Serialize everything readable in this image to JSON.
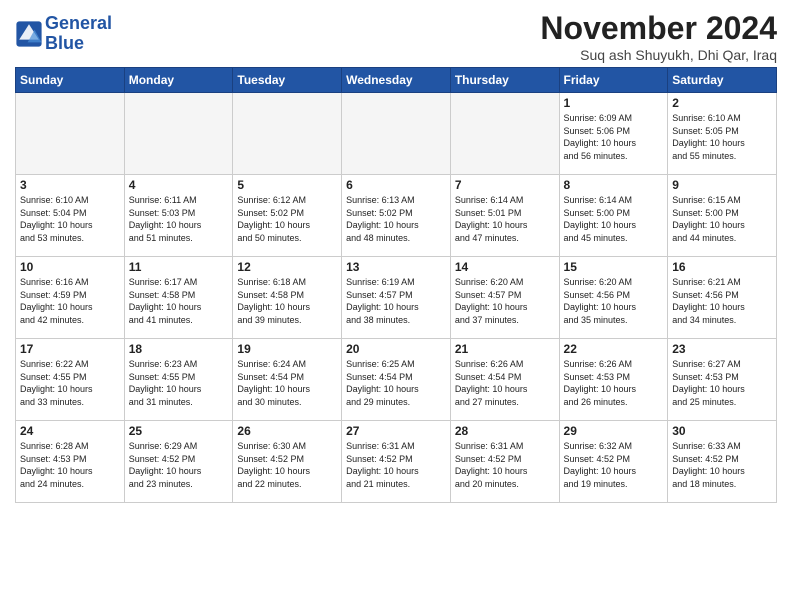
{
  "logo": {
    "line1": "General",
    "line2": "Blue"
  },
  "title": "November 2024",
  "subtitle": "Suq ash Shuyukh, Dhi Qar, Iraq",
  "weekdays": [
    "Sunday",
    "Monday",
    "Tuesday",
    "Wednesday",
    "Thursday",
    "Friday",
    "Saturday"
  ],
  "weeks": [
    [
      {
        "day": "",
        "info": ""
      },
      {
        "day": "",
        "info": ""
      },
      {
        "day": "",
        "info": ""
      },
      {
        "day": "",
        "info": ""
      },
      {
        "day": "",
        "info": ""
      },
      {
        "day": "1",
        "info": "Sunrise: 6:09 AM\nSunset: 5:06 PM\nDaylight: 10 hours\nand 56 minutes."
      },
      {
        "day": "2",
        "info": "Sunrise: 6:10 AM\nSunset: 5:05 PM\nDaylight: 10 hours\nand 55 minutes."
      }
    ],
    [
      {
        "day": "3",
        "info": "Sunrise: 6:10 AM\nSunset: 5:04 PM\nDaylight: 10 hours\nand 53 minutes."
      },
      {
        "day": "4",
        "info": "Sunrise: 6:11 AM\nSunset: 5:03 PM\nDaylight: 10 hours\nand 51 minutes."
      },
      {
        "day": "5",
        "info": "Sunrise: 6:12 AM\nSunset: 5:02 PM\nDaylight: 10 hours\nand 50 minutes."
      },
      {
        "day": "6",
        "info": "Sunrise: 6:13 AM\nSunset: 5:02 PM\nDaylight: 10 hours\nand 48 minutes."
      },
      {
        "day": "7",
        "info": "Sunrise: 6:14 AM\nSunset: 5:01 PM\nDaylight: 10 hours\nand 47 minutes."
      },
      {
        "day": "8",
        "info": "Sunrise: 6:14 AM\nSunset: 5:00 PM\nDaylight: 10 hours\nand 45 minutes."
      },
      {
        "day": "9",
        "info": "Sunrise: 6:15 AM\nSunset: 5:00 PM\nDaylight: 10 hours\nand 44 minutes."
      }
    ],
    [
      {
        "day": "10",
        "info": "Sunrise: 6:16 AM\nSunset: 4:59 PM\nDaylight: 10 hours\nand 42 minutes."
      },
      {
        "day": "11",
        "info": "Sunrise: 6:17 AM\nSunset: 4:58 PM\nDaylight: 10 hours\nand 41 minutes."
      },
      {
        "day": "12",
        "info": "Sunrise: 6:18 AM\nSunset: 4:58 PM\nDaylight: 10 hours\nand 39 minutes."
      },
      {
        "day": "13",
        "info": "Sunrise: 6:19 AM\nSunset: 4:57 PM\nDaylight: 10 hours\nand 38 minutes."
      },
      {
        "day": "14",
        "info": "Sunrise: 6:20 AM\nSunset: 4:57 PM\nDaylight: 10 hours\nand 37 minutes."
      },
      {
        "day": "15",
        "info": "Sunrise: 6:20 AM\nSunset: 4:56 PM\nDaylight: 10 hours\nand 35 minutes."
      },
      {
        "day": "16",
        "info": "Sunrise: 6:21 AM\nSunset: 4:56 PM\nDaylight: 10 hours\nand 34 minutes."
      }
    ],
    [
      {
        "day": "17",
        "info": "Sunrise: 6:22 AM\nSunset: 4:55 PM\nDaylight: 10 hours\nand 33 minutes."
      },
      {
        "day": "18",
        "info": "Sunrise: 6:23 AM\nSunset: 4:55 PM\nDaylight: 10 hours\nand 31 minutes."
      },
      {
        "day": "19",
        "info": "Sunrise: 6:24 AM\nSunset: 4:54 PM\nDaylight: 10 hours\nand 30 minutes."
      },
      {
        "day": "20",
        "info": "Sunrise: 6:25 AM\nSunset: 4:54 PM\nDaylight: 10 hours\nand 29 minutes."
      },
      {
        "day": "21",
        "info": "Sunrise: 6:26 AM\nSunset: 4:54 PM\nDaylight: 10 hours\nand 27 minutes."
      },
      {
        "day": "22",
        "info": "Sunrise: 6:26 AM\nSunset: 4:53 PM\nDaylight: 10 hours\nand 26 minutes."
      },
      {
        "day": "23",
        "info": "Sunrise: 6:27 AM\nSunset: 4:53 PM\nDaylight: 10 hours\nand 25 minutes."
      }
    ],
    [
      {
        "day": "24",
        "info": "Sunrise: 6:28 AM\nSunset: 4:53 PM\nDaylight: 10 hours\nand 24 minutes."
      },
      {
        "day": "25",
        "info": "Sunrise: 6:29 AM\nSunset: 4:52 PM\nDaylight: 10 hours\nand 23 minutes."
      },
      {
        "day": "26",
        "info": "Sunrise: 6:30 AM\nSunset: 4:52 PM\nDaylight: 10 hours\nand 22 minutes."
      },
      {
        "day": "27",
        "info": "Sunrise: 6:31 AM\nSunset: 4:52 PM\nDaylight: 10 hours\nand 21 minutes."
      },
      {
        "day": "28",
        "info": "Sunrise: 6:31 AM\nSunset: 4:52 PM\nDaylight: 10 hours\nand 20 minutes."
      },
      {
        "day": "29",
        "info": "Sunrise: 6:32 AM\nSunset: 4:52 PM\nDaylight: 10 hours\nand 19 minutes."
      },
      {
        "day": "30",
        "info": "Sunrise: 6:33 AM\nSunset: 4:52 PM\nDaylight: 10 hours\nand 18 minutes."
      }
    ]
  ]
}
